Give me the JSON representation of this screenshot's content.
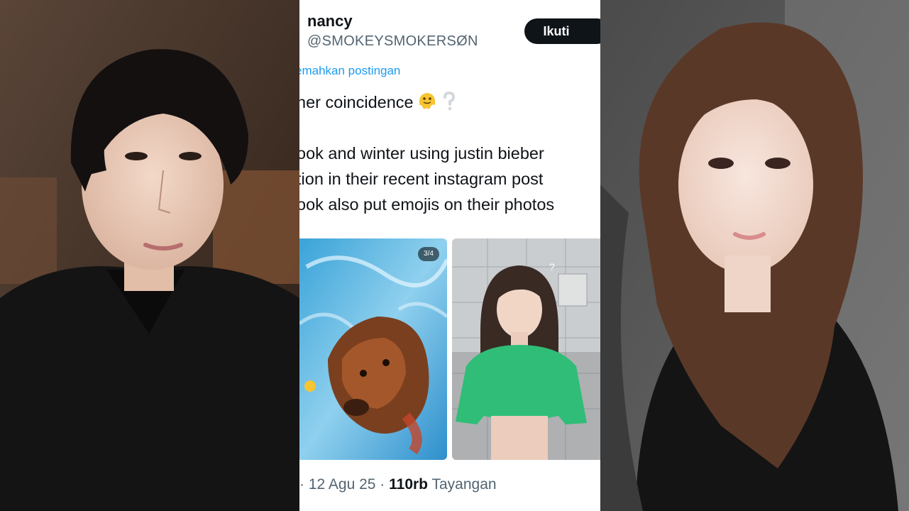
{
  "tweet": {
    "author_name": "nancy",
    "author_handle": "@SMOKEYSMOKERSØN",
    "follow_label": "Ikuti",
    "translate_label": "emahkan postingan",
    "text_lines": [
      "her coincidence",
      "ook and winter using justin bieber",
      "tion in their recent instagram post",
      "ook also put emojis on their photos"
    ],
    "line1_emojis": [
      "melting-face-emoji",
      "white-question-mark-emoji"
    ],
    "media": {
      "photo_counter": "3/4",
      "left_image": "dog-in-pool-photo",
      "right_image": "girl-green-sweater-photo",
      "right_overlay": "?"
    },
    "meta": {
      "separator_lead": "·",
      "date": "12 Agu 25",
      "separator": "·",
      "views_count": "110rb",
      "views_label": "Tayangan"
    }
  },
  "colors": {
    "text_primary": "#0f1419",
    "text_secondary": "#536471",
    "link": "#1d9bf0",
    "button_bg": "#0f1419"
  },
  "side_photos": {
    "left": "man-dark-hair-portrait",
    "right": "woman-long-hair-portrait"
  }
}
